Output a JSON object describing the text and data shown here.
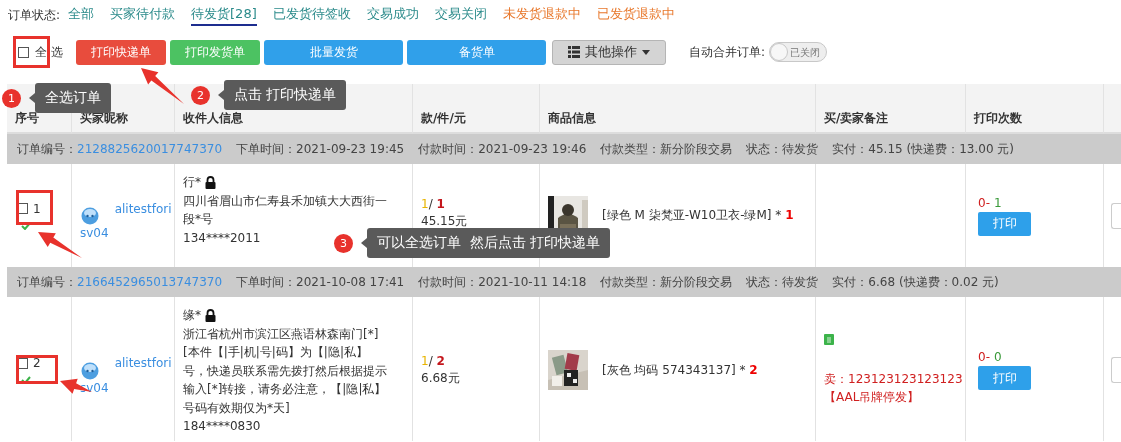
{
  "status_bar": {
    "label": "订单状态:",
    "tabs": [
      {
        "label": "全部",
        "selected": false,
        "kind": "normal"
      },
      {
        "label": "买家待付款",
        "selected": false,
        "kind": "normal"
      },
      {
        "label": "待发货[28]",
        "selected": true,
        "kind": "normal"
      },
      {
        "label": "已发货待签收",
        "selected": false,
        "kind": "normal"
      },
      {
        "label": "交易成功",
        "selected": false,
        "kind": "normal"
      },
      {
        "label": "交易关闭",
        "selected": false,
        "kind": "normal"
      },
      {
        "label": "未发货退款中",
        "selected": false,
        "kind": "refund"
      },
      {
        "label": "已发货退款中",
        "selected": false,
        "kind": "refund"
      }
    ]
  },
  "toolbar": {
    "select_all": {
      "label": "全选",
      "checked": false
    },
    "buttons": [
      {
        "label": "打印快递单",
        "color": "#e84c3d"
      },
      {
        "label": "打印发货单",
        "color": "#4cc262"
      },
      {
        "label": "批量发货",
        "color": "#30a0ea"
      },
      {
        "label": "备货单",
        "color": "#30a0ea"
      }
    ],
    "more": {
      "label": "其他操作"
    },
    "auto_merge": {
      "label": "自动合并订单:",
      "toggle_text": "已关闭",
      "on": false
    }
  },
  "table": {
    "columns": [
      "序号",
      "买家昵称",
      "收件人信息",
      "款/件/元",
      "商品信息",
      "买/卖家备注",
      "打印次数"
    ],
    "orders": [
      {
        "order_no_label": "订单编号：",
        "order_no": "2128825620017747370",
        "info": [
          "下单时间：2021-09-23 19:45",
          "付款时间：2021-09-23 19:46",
          "付款类型：新分阶段交易",
          "状态：待发货",
          "实付：45.15 (快递费：13.00 元)"
        ],
        "index": "1",
        "checked": false,
        "verified": true,
        "buyer": [
          "alitestfori",
          "sv04"
        ],
        "recipient": {
          "name": "行*",
          "address": "四川省眉山市仁寿县禾加镇大大西街一段*号",
          "phone": "134****2011"
        },
        "kinds": "1",
        "separator": "/",
        "count": "1",
        "price": "45.15元",
        "product": {
          "spec": "[绿色 M 柒梵亚-W10卫衣-绿M] *",
          "qty": "1"
        },
        "print_count": {
          "express": "0-",
          "ship": "1"
        },
        "print_button": "打印"
      },
      {
        "order_no_label": "订单编号：",
        "order_no": "2166452965013747370",
        "info": [
          "下单时间：2021-10-08 17:41",
          "付款时间：2021-10-11 14:18",
          "付款类型：新分阶段交易",
          "状态：待发货",
          "实付：6.68 (快递费：0.02 元)"
        ],
        "index": "2",
        "checked": false,
        "verified": true,
        "buyer": [
          "alitestfori",
          "sv04"
        ],
        "recipient": {
          "name": "缘*",
          "address": "浙江省杭州市滨江区燕语林森南门[*][本件【|手|机|号|码】为【|隐|私】号，快递员联系需先拨打然后根据提示输入[*]转接，请务必注意，【|隐|私】号码有效期仅为*天]",
          "phone": "184****0830"
        },
        "kinds": "1",
        "separator": "/",
        "count": "2",
        "price": "6.68元",
        "product": {
          "spec": "[灰色 均码 574343137] *",
          "qty": "2"
        },
        "remark": {
          "text": "卖：123123123123123",
          "tag": "【AAL吊牌停发】"
        },
        "print_count": {
          "express": "0-",
          "ship": "0"
        },
        "print_button": "打印"
      }
    ]
  },
  "annotations": [
    {
      "number": "1",
      "text": "全选订单"
    },
    {
      "number": "2",
      "text": "点击 打印快递单"
    },
    {
      "number": "3",
      "text": "可以全选订单  然后点击 打印快递单"
    }
  ]
}
